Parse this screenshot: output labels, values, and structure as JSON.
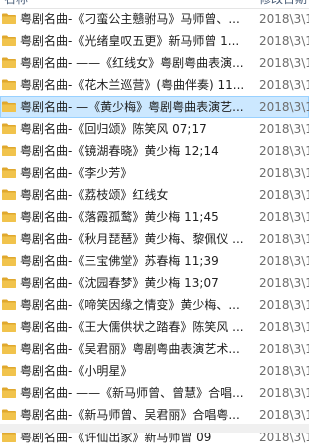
{
  "header": {
    "name_label": "名称",
    "date_label": "修改日期"
  },
  "files": [
    {
      "name": "粤剧名曲-《刁蛮公主戆驸马》马师曾、...",
      "date": "2018\\3\\1"
    },
    {
      "name": "粤剧名曲-《光绪皇叹五更》新马师曾 1...",
      "date": "2018\\3\\1"
    },
    {
      "name": "粤剧名曲- ——《红线女》粤剧粤曲表演...",
      "date": "2018\\3\\1"
    },
    {
      "name": "粤剧名曲-《花木兰巡营》(粤曲伴奏) 11...",
      "date": "2018\\3\\1"
    },
    {
      "name": "粤剧名曲- —《黄少梅》粤剧粤曲表演艺...",
      "date": "2018\\3\\1"
    },
    {
      "name": "粤剧名曲-《回归颂》陈笑风 07;17",
      "date": "2018\\3\\1"
    },
    {
      "name": "粤剧名曲-《镜湖春晓》黄少梅 12;14",
      "date": "2018\\3\\1"
    },
    {
      "name": "粤剧名曲-《李少芳》",
      "date": "2018\\3\\1"
    },
    {
      "name": "粤剧名曲-《荔枝颂》红线女",
      "date": "2018\\3\\1"
    },
    {
      "name": "粤剧名曲-《落霞孤鹜》黄少梅 11;45",
      "date": "2018\\3\\1"
    },
    {
      "name": "粤剧名曲-《秋月琵琶》黄少梅、黎佩仪 ...",
      "date": "2018\\3\\1"
    },
    {
      "name": "粤剧名曲-《三宝佛堂》苏春梅 11;39",
      "date": "2018\\3\\1"
    },
    {
      "name": "粤剧名曲-《沈园春梦》黄少梅 13;07",
      "date": "2018\\3\\1"
    },
    {
      "name": "粤剧名曲-《啼笑因缘之情变》黄少梅、...",
      "date": "2018\\3\\1"
    },
    {
      "name": "粤剧名曲-《王大儒供状之踏春》陈笑风 ...",
      "date": "2018\\3\\1"
    },
    {
      "name": "粤剧名曲-《吴君丽》粤剧粤曲表演艺术...",
      "date": "2018\\3\\1"
    },
    {
      "name": "粤剧名曲-《小明星》",
      "date": "2018\\3\\1"
    },
    {
      "name": "粤剧名曲- ——《新马师曾、曾慧》合唱...",
      "date": "2018\\3\\1"
    },
    {
      "name": "粤剧名曲-《新马师曾、吴君丽》合唱粤...",
      "date": "2018\\3\\1"
    },
    {
      "name": "粤剧名曲-《许仙出家》新马师曾 09",
      "date": "2018\\3\\1"
    }
  ],
  "selected_row_name": "粤剧名曲- —《黄少梅》粤剧粤曲表演艺...",
  "colors": {
    "selected_bg": "#cce8ff",
    "selected_border": "#99d1ff",
    "folder_yellow": "#f1c34c"
  }
}
